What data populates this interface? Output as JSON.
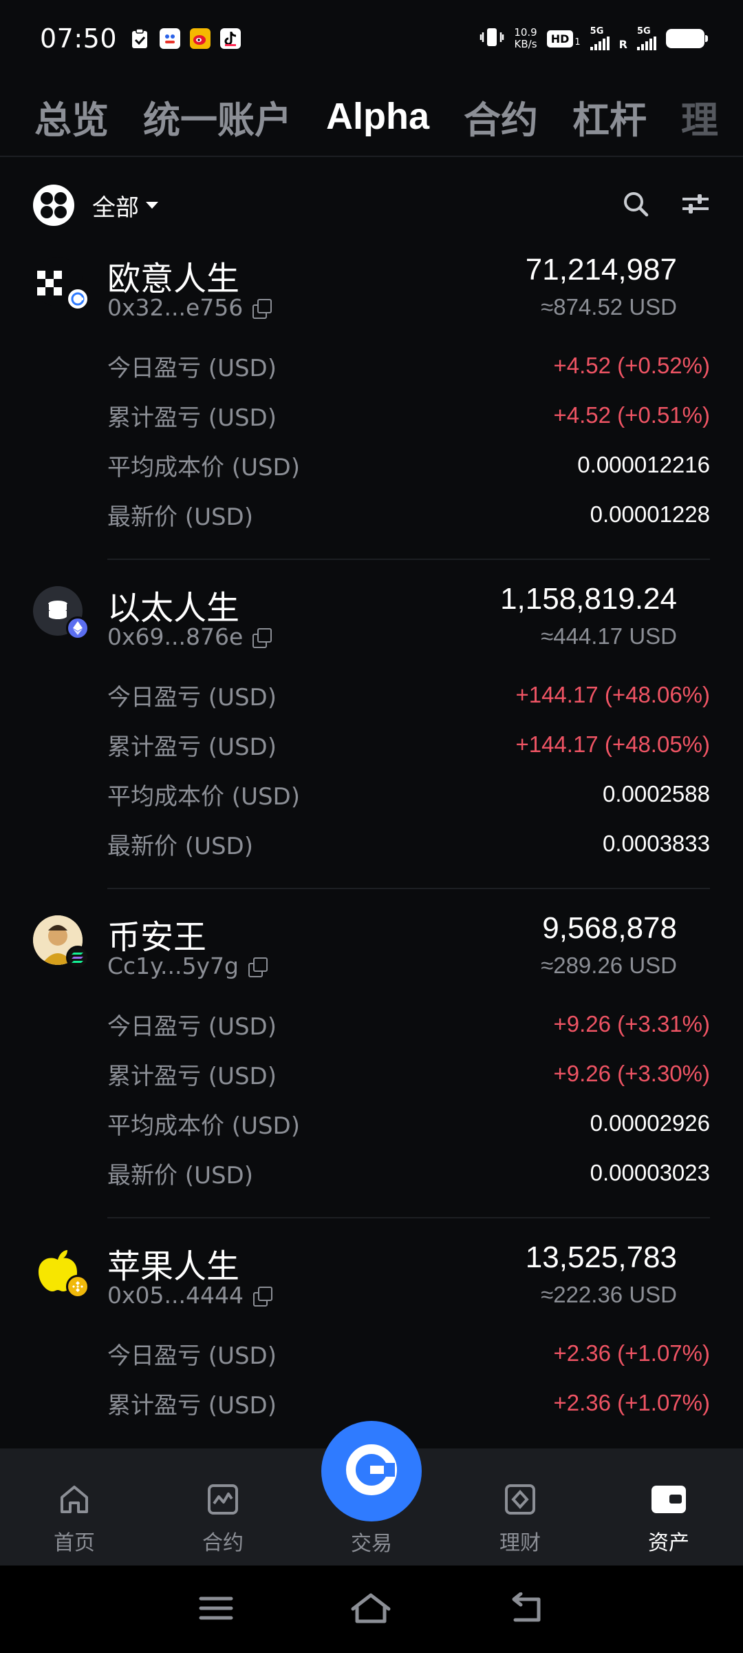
{
  "status_bar": {
    "time": "07:50",
    "net_speed_value": "10.9",
    "net_speed_unit": "KB/s",
    "hd_label": "HD",
    "hd_sub": "1",
    "sim1_label": "5G",
    "sim2_label": "5G",
    "roaming": "R"
  },
  "top_tabs": [
    {
      "label": "总览"
    },
    {
      "label": "统一账户"
    },
    {
      "label": "Alpha"
    },
    {
      "label": "合约"
    },
    {
      "label": "杠杆"
    },
    {
      "label": "理"
    }
  ],
  "filter": {
    "label": "全部"
  },
  "assets": [
    {
      "name": "欧意人生",
      "address": "0x32...e756",
      "amount": "71,214,987",
      "usd_value": "≈874.52 USD",
      "rows": [
        {
          "label": "今日盈亏 (USD)",
          "value": "+4.52 (+0.52%)",
          "positive": true
        },
        {
          "label": "累计盈亏 (USD)",
          "value": "+4.52 (+0.51%)",
          "positive": true
        },
        {
          "label": "平均成本价 (USD)",
          "value": "0.000012216",
          "positive": false
        },
        {
          "label": "最新价 (USD)",
          "value": "0.00001228",
          "positive": false
        }
      ]
    },
    {
      "name": "以太人生",
      "address": "0x69...876e",
      "amount": "1,158,819.24",
      "usd_value": "≈444.17 USD",
      "rows": [
        {
          "label": "今日盈亏 (USD)",
          "value": "+144.17 (+48.06%)",
          "positive": true
        },
        {
          "label": "累计盈亏 (USD)",
          "value": "+144.17 (+48.05%)",
          "positive": true
        },
        {
          "label": "平均成本价 (USD)",
          "value": "0.0002588",
          "positive": false
        },
        {
          "label": "最新价 (USD)",
          "value": "0.0003833",
          "positive": false
        }
      ]
    },
    {
      "name": "币安王",
      "address": "Cc1y...5y7g",
      "amount": "9,568,878",
      "usd_value": "≈289.26 USD",
      "rows": [
        {
          "label": "今日盈亏 (USD)",
          "value": "+9.26 (+3.31%)",
          "positive": true
        },
        {
          "label": "累计盈亏 (USD)",
          "value": "+9.26 (+3.30%)",
          "positive": true
        },
        {
          "label": "平均成本价 (USD)",
          "value": "0.00002926",
          "positive": false
        },
        {
          "label": "最新价 (USD)",
          "value": "0.00003023",
          "positive": false
        }
      ]
    },
    {
      "name": "苹果人生",
      "address": "0x05...4444",
      "amount": "13,525,783",
      "usd_value": "≈222.36 USD",
      "rows": [
        {
          "label": "今日盈亏 (USD)",
          "value": "+2.36 (+1.07%)",
          "positive": true
        },
        {
          "label": "累计盈亏 (USD)",
          "value": "+2.36 (+1.07%)",
          "positive": true
        }
      ]
    }
  ],
  "bottom_nav": {
    "home": "首页",
    "futures": "合约",
    "trade": "交易",
    "earn": "理财",
    "assets": "资产"
  },
  "colors": {
    "background": "#0a0b0d",
    "positive": "#ef5464",
    "accent": "#2f7bff",
    "muted": "#8c8f96"
  }
}
